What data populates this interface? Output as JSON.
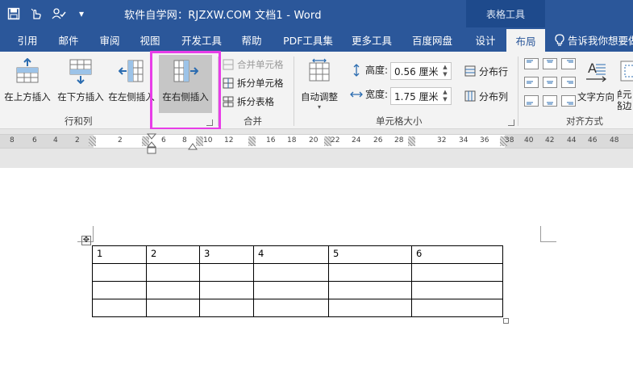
{
  "titlebar": {
    "title": "软件自学网：RJZXW.COM  文档1  -  Word",
    "context_tab_group": "表格工具",
    "qat_customize": "▾"
  },
  "tabs": [
    {
      "label": "引用"
    },
    {
      "label": "邮件"
    },
    {
      "label": "审阅"
    },
    {
      "label": "视图"
    },
    {
      "label": "开发工具"
    },
    {
      "label": "帮助"
    },
    {
      "label": "PDF工具集"
    },
    {
      "label": "更多工具"
    },
    {
      "label": "百度网盘"
    },
    {
      "label": "设计"
    },
    {
      "label": "布局"
    }
  ],
  "tell_me": "告诉我你想要做",
  "rows_cols": {
    "insert_above": "在上方插入",
    "insert_below": "在下方插入",
    "insert_left": "在左侧插入",
    "insert_right": "在右侧插入",
    "group_label": "行和列"
  },
  "merge": {
    "merge_cells": "合并单元格",
    "split_cells": "拆分单元格",
    "split_table": "拆分表格",
    "group_label": "合并"
  },
  "cell_size": {
    "autofit": "自动调整",
    "height_label": "高度:",
    "height_value": "0.56 厘米",
    "width_label": "宽度:",
    "width_value": "1.75 厘米",
    "distribute_rows": "分布行",
    "distribute_cols": "分布列",
    "group_label": "单元格大小"
  },
  "alignment": {
    "text_direction": "文字方向",
    "cell_margins": "单元格边距",
    "group_label": "对齐方式"
  },
  "ruler": {
    "ticks": [
      "8",
      "6",
      "4",
      "2",
      "2",
      "6",
      "8",
      "10",
      "12",
      "16",
      "18",
      "20",
      "22",
      "24",
      "26",
      "28",
      "32",
      "34",
      "36",
      "38",
      "40",
      "42",
      "44",
      "46",
      "48"
    ]
  },
  "table": {
    "rows": [
      [
        "1",
        "2",
        "3",
        "4",
        "5",
        "6"
      ],
      [
        "",
        "",
        "",
        "",
        "",
        ""
      ],
      [
        "",
        "",
        "",
        "",
        "",
        ""
      ],
      [
        "",
        "",
        "",
        "",
        "",
        ""
      ]
    ]
  },
  "colors": {
    "word_blue": "#2b579a",
    "highlight_box": "#e83de8"
  }
}
